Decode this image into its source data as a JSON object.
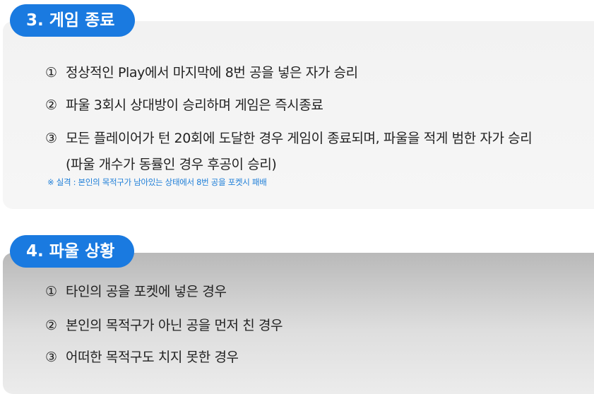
{
  "sections": {
    "game_end": {
      "title": "3. 게임 종료",
      "items": [
        {
          "num": "①",
          "text": "정상적인 Play에서 마지막에 8번 공을 넣은 자가 승리"
        },
        {
          "num": "②",
          "text": "파울 3회시 상대방이 승리하며 게임은 즉시종료"
        },
        {
          "num": "③",
          "text": "모든 플레이어가 턴 20회에 도달한 경우 게임이 종료되며, 파울을 적게 범한 자가 승리"
        }
      ],
      "item3_continuation": "(파울 개수가 동률인 경우 후공이 승리)",
      "note": "※ 실격 : 본인의 목적구가 남아있는 상태에서 8번 공을 포켓시 패배"
    },
    "foul": {
      "title": "4. 파울 상황",
      "items": [
        {
          "num": "①",
          "text": "타인의 공을 포켓에 넣은 경우"
        },
        {
          "num": "②",
          "text": "본인의 목적구가 아닌 공을 먼저 친 경우"
        },
        {
          "num": "③",
          "text": "어떠한 목적구도 치지 못한 경우"
        }
      ]
    }
  },
  "colors": {
    "accent": "#1a7ae0",
    "note": "#1f7fd8",
    "text": "#222222"
  }
}
